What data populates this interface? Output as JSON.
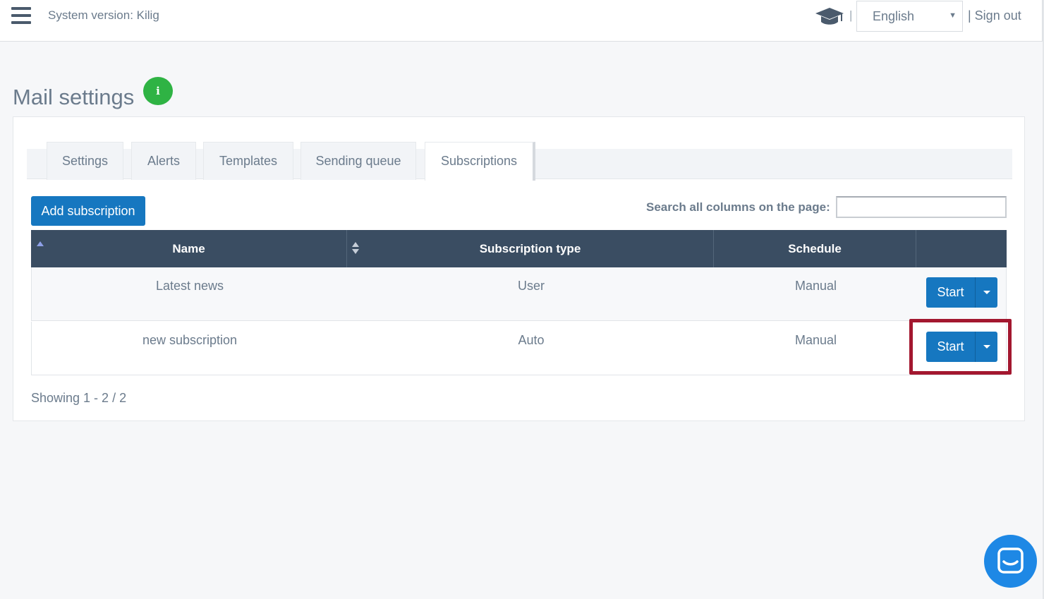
{
  "header": {
    "system_version": "System version: Kilig",
    "separator": "|",
    "language": "English",
    "signout": "| Sign out"
  },
  "page": {
    "title": "Mail settings",
    "info_glyph": "i"
  },
  "tabs": [
    {
      "label": "Settings"
    },
    {
      "label": "Alerts"
    },
    {
      "label": "Templates"
    },
    {
      "label": "Sending queue"
    },
    {
      "label": "Subscriptions",
      "active": true
    }
  ],
  "toolbar": {
    "add_label": "Add subscription",
    "search_label": "Search all columns on the page:",
    "search_value": ""
  },
  "table": {
    "columns": [
      "Name",
      "Subscription type",
      "Schedule",
      ""
    ],
    "rows": [
      {
        "name": "Latest news",
        "type": "User",
        "schedule": "Manual",
        "action": "Start"
      },
      {
        "name": "new subscription",
        "type": "Auto",
        "schedule": "Manual",
        "action": "Start"
      }
    ]
  },
  "footer": {
    "showing": "Showing 1 - 2 / 2"
  },
  "colors": {
    "primary": "#1677c0",
    "header_bg": "#3a4d62",
    "info_green": "#2fb344",
    "highlight": "#a3172f",
    "chat": "#1e88e5"
  },
  "icons": [
    "hamburger-menu-icon",
    "graduation-cap-icon",
    "info-icon",
    "chevron-down-icon",
    "chat-icon"
  ]
}
